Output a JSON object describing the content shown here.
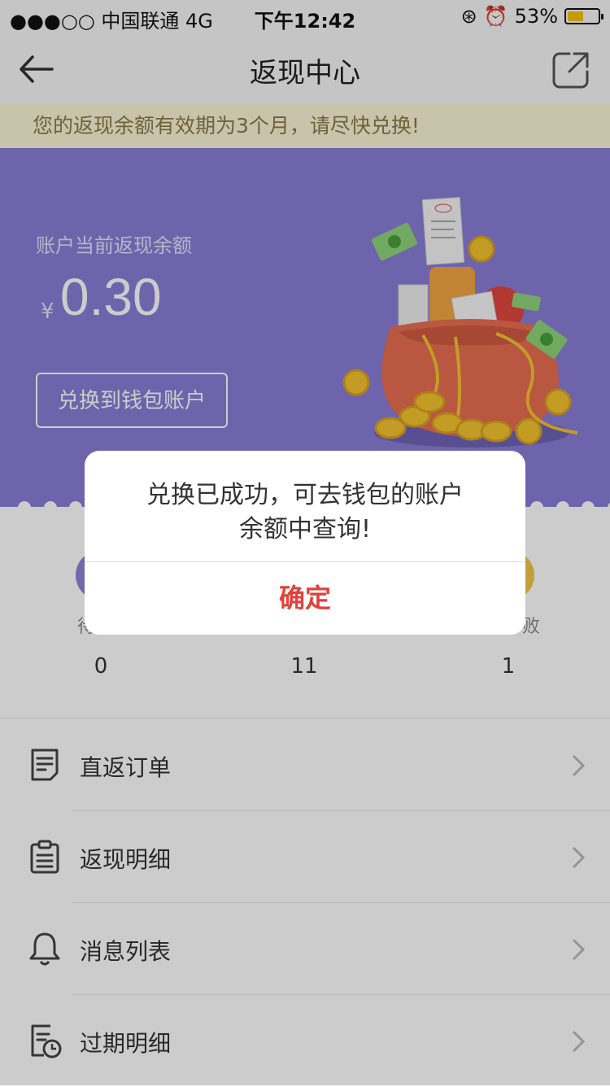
{
  "status_bar": {
    "carrier": "●●●○○ 中国联通  4G",
    "time": "下午12:42",
    "battery_pct": "53%",
    "battery_level": 0.53,
    "battery_color": "#f5c400"
  },
  "nav": {
    "title": "返现中心",
    "back_icon": "arrow-left-icon",
    "share_icon": "share-icon"
  },
  "notice": "您的返现余额有效期为3个月，请尽快兑换!",
  "hero": {
    "label": "账户当前返现余额",
    "currency": "¥",
    "amount": "0.30",
    "exchange_button": "兑换到钱包账户",
    "background": "#8a7dd6"
  },
  "stats": [
    {
      "label_fragment": "待",
      "value": "0",
      "color": "#8f82d8"
    },
    {
      "label_fragment": "",
      "value": "11",
      "color": "#7ac1f0"
    },
    {
      "label_fragment": "败",
      "value": "1",
      "color": "#f2c94c"
    }
  ],
  "menu": [
    {
      "label": "直返订单",
      "icon": "order-list-icon"
    },
    {
      "label": "返现明细",
      "icon": "clipboard-icon"
    },
    {
      "label": "消息列表",
      "icon": "bell-icon"
    },
    {
      "label": "过期明细",
      "icon": "expired-calendar-icon"
    }
  ],
  "modal": {
    "line1": "兑换已成功，可去钱包的账户",
    "line2": "余额中查询!",
    "confirm": "确定",
    "confirm_color": "#e2413b"
  }
}
